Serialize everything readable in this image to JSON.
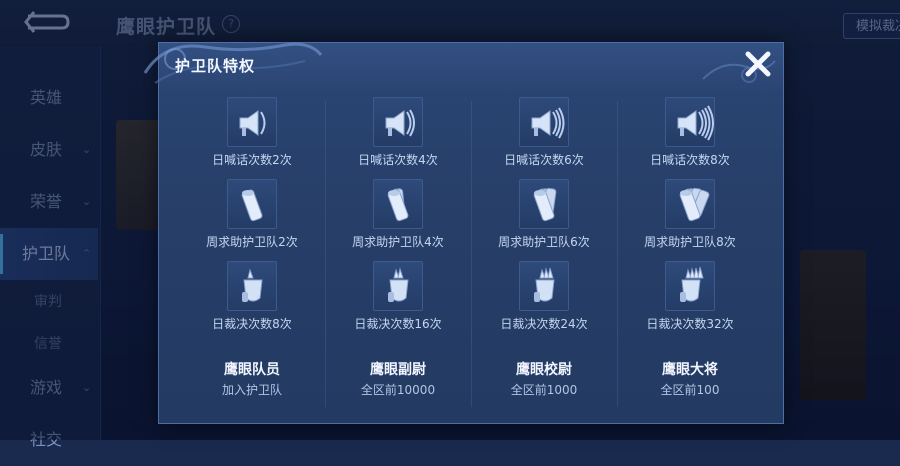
{
  "header": {
    "title": "鹰眼护卫队",
    "help": "?",
    "right_button": "模拟裁决"
  },
  "sidebar": {
    "items": [
      {
        "label": "英雄",
        "chevron": ""
      },
      {
        "label": "皮肤",
        "chevron": "⌄"
      },
      {
        "label": "荣誉",
        "chevron": "⌄"
      },
      {
        "label": "护卫队",
        "chevron": "⌃"
      },
      {
        "label": "审判",
        "chevron": ""
      },
      {
        "label": "信誉",
        "chevron": ""
      },
      {
        "label": "游戏",
        "chevron": "⌄"
      },
      {
        "label": "社交",
        "chevron": ""
      }
    ]
  },
  "modal": {
    "title": "护卫队特权",
    "close_label": "✕",
    "tiers": [
      {
        "name": "鹰眼队员",
        "requirement": "加入护卫队",
        "perks": [
          {
            "icon": "megaphone-icon",
            "label": "日喊话次数2次"
          },
          {
            "icon": "scroll-icon",
            "label": "周求助护卫队2次"
          },
          {
            "icon": "gavel-icon",
            "label": "日裁决次数8次"
          }
        ]
      },
      {
        "name": "鹰眼副尉",
        "requirement": "全区前10000",
        "perks": [
          {
            "icon": "megaphone-icon",
            "label": "日喊话次数4次"
          },
          {
            "icon": "scroll-icon",
            "label": "周求助护卫队4次"
          },
          {
            "icon": "gavel-icon",
            "label": "日裁决次数16次"
          }
        ]
      },
      {
        "name": "鹰眼校尉",
        "requirement": "全区前1000",
        "perks": [
          {
            "icon": "megaphone-icon",
            "label": "日喊话次数6次"
          },
          {
            "icon": "scroll-icon",
            "label": "周求助护卫队6次"
          },
          {
            "icon": "gavel-icon",
            "label": "日裁决次数24次"
          }
        ]
      },
      {
        "name": "鹰眼大将",
        "requirement": "全区前100",
        "perks": [
          {
            "icon": "megaphone-icon",
            "label": "日喊话次数8次"
          },
          {
            "icon": "scroll-icon",
            "label": "周求助护卫队8次"
          },
          {
            "icon": "gavel-icon",
            "label": "日裁决次数32次"
          }
        ]
      }
    ]
  },
  "colors": {
    "accent": "#5cc3ff",
    "modal_bg": "#273f69",
    "text_primary": "#f1f5ff",
    "text_secondary": "#c6d6f2"
  }
}
